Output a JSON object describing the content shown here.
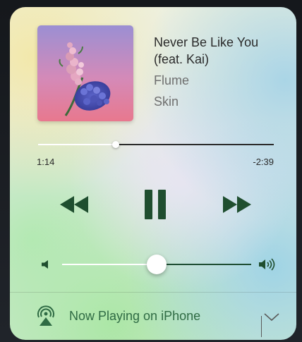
{
  "now_playing": {
    "title": "Never Be Like You (feat. Kai)",
    "artist": "Flume",
    "album": "Skin",
    "album_art": "flower-album-art"
  },
  "playback": {
    "elapsed": "1:14",
    "remaining": "-2:39",
    "progress": 0.33,
    "state": "playing"
  },
  "controls": {
    "rewind": "rewind-icon",
    "pause": "pause-icon",
    "forward": "fast-forward-icon"
  },
  "volume": {
    "level": 0.5,
    "low_icon": "volume-low-icon",
    "high_icon": "volume-high-icon"
  },
  "output": {
    "prefix": "Now Playing on",
    "device": "iPhone",
    "icon": "airplay-icon",
    "chevron": "chevron-down-icon"
  },
  "colors": {
    "accent": "#2f6b44",
    "slider_dark": "#1e4d33",
    "text_primary": "#2a2a2a",
    "text_secondary": "#6f6f6f"
  }
}
